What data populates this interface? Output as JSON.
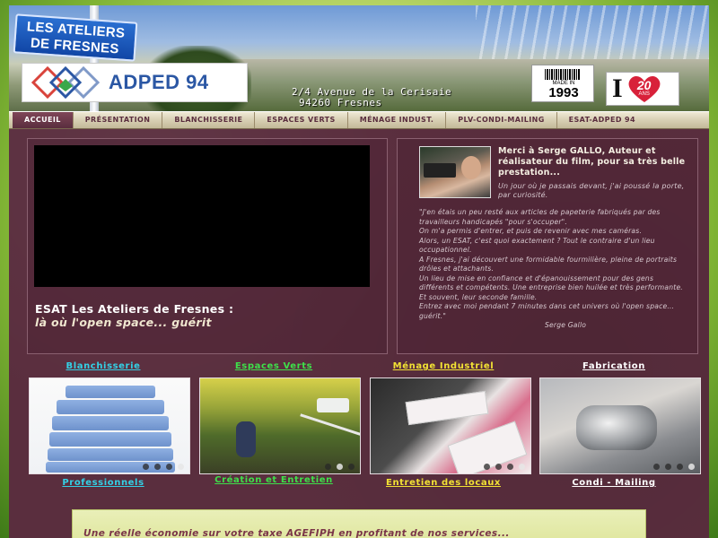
{
  "header": {
    "sign_line1": "LES ATELIERS",
    "sign_line2": "DE FRESNES",
    "logo_text": "ADPED 94",
    "address_line1": "2/4 Avenue de la Cerisaie",
    "address_line2": "94260 Fresnes",
    "made_in": "MADE IN",
    "made_year": "1993",
    "anniv_i": "I",
    "anniv_number": "20",
    "anniv_unit": "ANS"
  },
  "nav": {
    "items": [
      {
        "label": "ACCUEIL"
      },
      {
        "label": "PRÉSENTATION"
      },
      {
        "label": "BLANCHISSERIE"
      },
      {
        "label": "ESPACES VERTS"
      },
      {
        "label": "MÉNAGE INDUST."
      },
      {
        "label": "PLV-CONDI-MAILING"
      },
      {
        "label": "ESAT-ADPED 94"
      }
    ],
    "active_index": 0
  },
  "video": {
    "caption_line1": "ESAT Les Ateliers de Fresnes :",
    "caption_line2": "là où l'open space... guérit"
  },
  "testimonial": {
    "thanks": "Merci à Serge GALLO, Auteur et réalisateur du film, pour sa très belle prestation...",
    "intro": "Un jour où je passais devant, j'ai poussé la porte, par curiosité.",
    "quote_lines": [
      "\"J'en étais un peu resté aux articles de papeterie fabriqués par des travailleurs handicapés \"pour s'occuper\".",
      "On m'a permis d'entrer, et puis de revenir avec mes caméras.",
      "Alors, un ESAT, c'est quoi exactement ? Tout le contraire d'un lieu occupationnel.",
      "A Fresnes, j'ai découvert une formidable fourmilière, pleine de portraits drôles et attachants.",
      "Un lieu de mise en confiance et d'épanouissement pour des gens différents et compétents. Une entreprise bien huilée et très performante. Et souvent, leur seconde famille.",
      "Entrez avec moi pendant 7 minutes dans cet univers où l'open space... guérit.\""
    ],
    "author": "Serge Gallo"
  },
  "categories": [
    {
      "title": "Blanchisserie",
      "subtitle": "Professionnels",
      "title_color": "#33d1e6",
      "subtitle_color": "#33d1e6"
    },
    {
      "title": "Espaces Verts",
      "subtitle": "Création et Entretien",
      "title_color": "#3ee04a",
      "subtitle_color": "#3ee04a"
    },
    {
      "title": "Ménage Industriel",
      "subtitle": "Entretien des locaux",
      "title_color": "#f2e234",
      "subtitle_color": "#f2e234"
    },
    {
      "title": "Fabrication",
      "subtitle": "Condi - Mailing",
      "title_color": "#ffffff",
      "subtitle_color": "#ffffff"
    }
  ],
  "banner": {
    "text": "Une réelle économie sur votre taxe AGEFIPH en profitant de nos services..."
  },
  "colors": {
    "page_bg": "#5a2e3e",
    "nav_bg": "#d7cfb3",
    "banner_bg": "#dfe69d",
    "banner_text": "#7a3548",
    "logo_blue": "#2b57a4"
  }
}
